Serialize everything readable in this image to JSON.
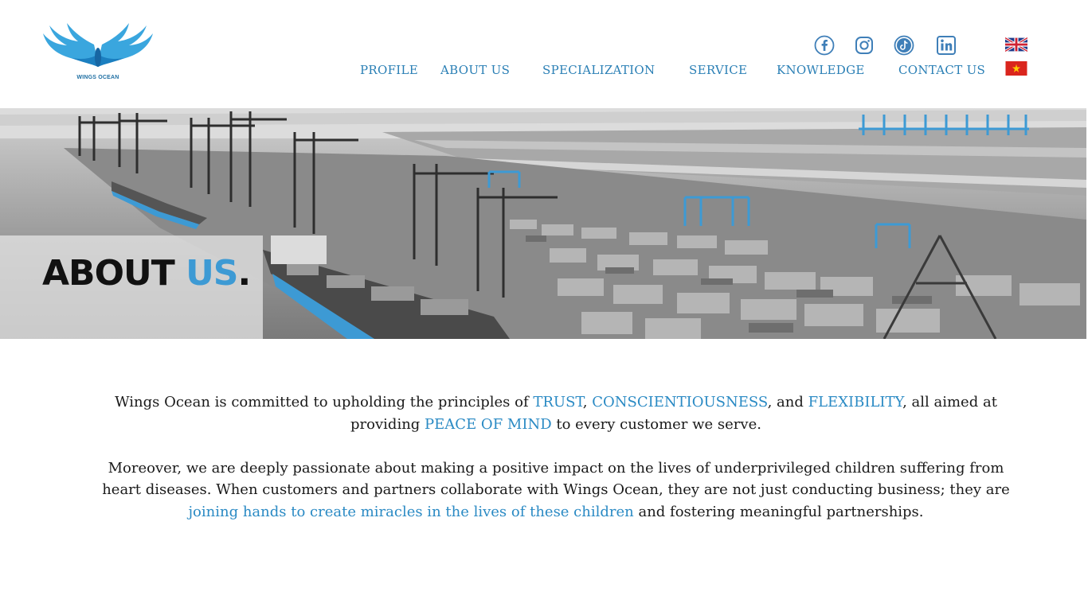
{
  "brand": {
    "logo_text": "WINGS OCEAN",
    "logo_icon": "wings-icon",
    "accent_color": "#2a7fb5",
    "highlight_color": "#3d9ad4"
  },
  "social": [
    {
      "name": "facebook",
      "icon": "facebook-icon"
    },
    {
      "name": "instagram",
      "icon": "instagram-icon"
    },
    {
      "name": "tiktok",
      "icon": "tiktok-icon"
    },
    {
      "name": "linkedin",
      "icon": "linkedin-icon"
    }
  ],
  "nav": {
    "items": [
      {
        "label": "PROFILE"
      },
      {
        "label": "ABOUT US"
      },
      {
        "label": "SPECIALIZATION"
      },
      {
        "label": "SERVICE"
      },
      {
        "label": "KNOWLEDGE"
      },
      {
        "label": "CONTACT US"
      }
    ]
  },
  "languages": [
    {
      "code": "en",
      "icon": "uk-flag-icon"
    },
    {
      "code": "vi",
      "icon": "vietnam-flag-icon"
    }
  ],
  "hero": {
    "title_part1": "ABOUT",
    "title_part2": "US",
    "title_dot": "."
  },
  "intro": {
    "p1": {
      "t1": "Wings Ocean is committed to upholding the principles of ",
      "h1": "TRUST",
      "t2": ", ",
      "h2": "CONSCIENTIOUSNESS",
      "t3": ", and ",
      "h3": "FLEXIBILITY",
      "t4": ", all aimed at providing ",
      "h4": "PEACE OF MIND",
      "t5": " to every customer we serve."
    },
    "p2": {
      "t1": "Moreover, we are deeply passionate about making a positive impact on the lives of underprivileged children suffering from heart diseases. When customers and partners collaborate with Wings Ocean, they are not just conducting business; they are ",
      "h1": "joining hands to create miracles in the lives of these children",
      "t2": " and fostering meaningful partnerships."
    }
  }
}
